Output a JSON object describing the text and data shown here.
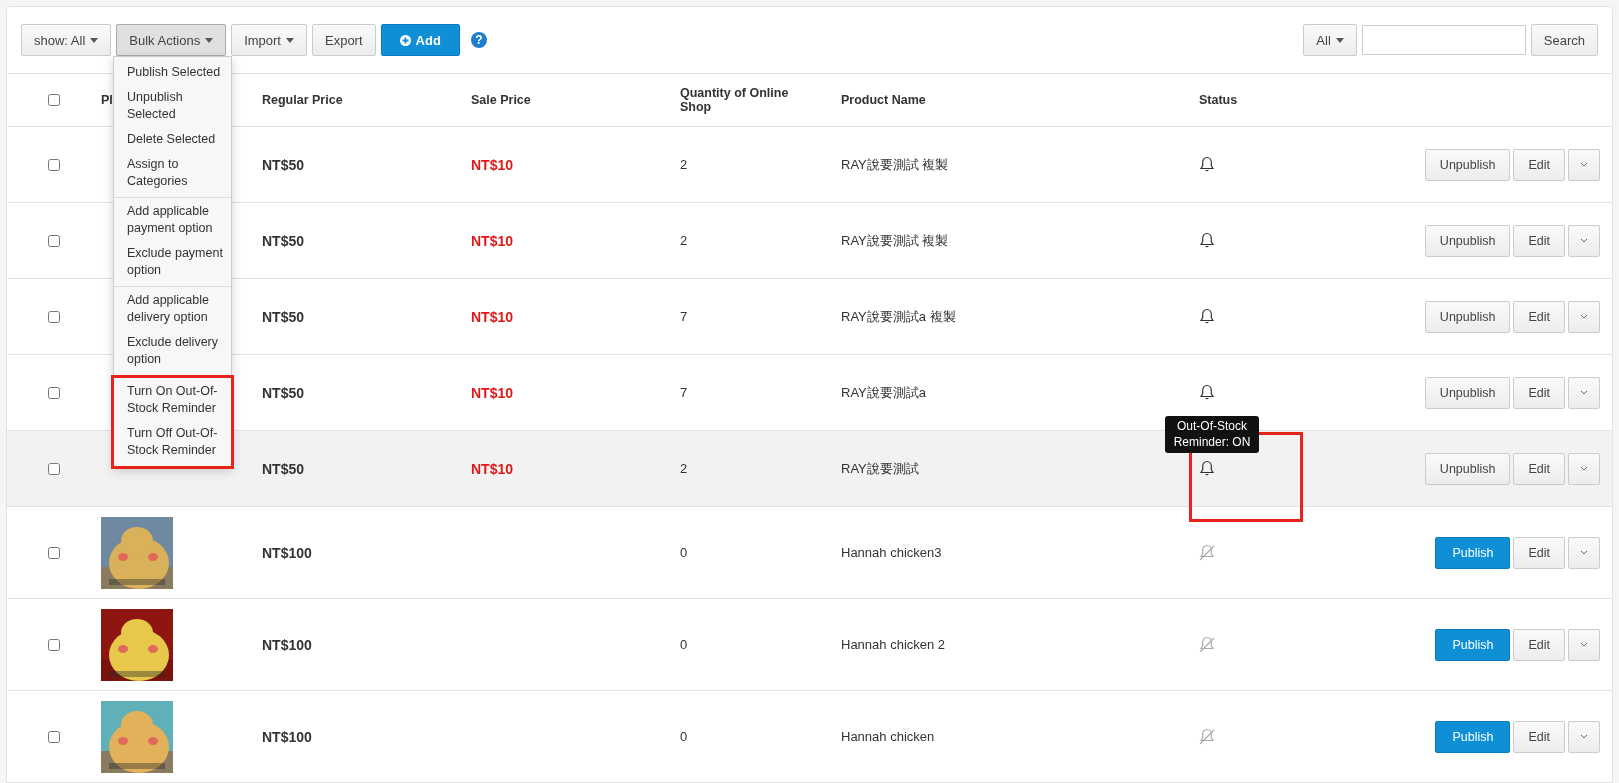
{
  "toolbar": {
    "buttons": [
      {
        "label": "show: All",
        "kind": "dropdown",
        "open": false
      },
      {
        "label": "Bulk Actions",
        "kind": "dropdown",
        "open": true
      },
      {
        "label": "Import",
        "kind": "dropdown",
        "open": false
      },
      {
        "label": "Export",
        "kind": "plain",
        "open": false
      },
      {
        "label": "Add",
        "kind": "primary",
        "open": false
      }
    ],
    "help": "?",
    "filter": {
      "label": "All"
    },
    "search": {
      "button": "Search"
    }
  },
  "bulk_menu": {
    "groups": [
      {
        "highlighted": false,
        "items": [
          "Publish Selected",
          "Unpublish Selected",
          "Delete Selected",
          "Assign to Categories"
        ]
      },
      {
        "highlighted": false,
        "items": [
          "Add applicable payment option",
          "Exclude payment option"
        ]
      },
      {
        "highlighted": false,
        "items": [
          "Add applicable delivery option",
          "Exclude delivery option"
        ]
      },
      {
        "highlighted": true,
        "items": [
          "Turn On Out-Of-Stock Reminder",
          "Turn Off Out-Of-Stock Reminder"
        ]
      }
    ]
  },
  "table": {
    "header_checked": false,
    "columns": [
      "Pl",
      "Regular Price",
      "Sale Price",
      "Quantity of Online Shop",
      "Product Name",
      "Status"
    ],
    "rows": [
      {
        "checked": false,
        "photo": null,
        "regular_price": "NT$50",
        "sale_price": "NT$10",
        "quantity": "2",
        "name": "RAY說要測試 複製",
        "reminder_on": true,
        "hovered": false,
        "highlighted": false,
        "action": {
          "label": "Unpublish",
          "kind": "default"
        },
        "edit": "Edit"
      },
      {
        "checked": false,
        "photo": null,
        "regular_price": "NT$50",
        "sale_price": "NT$10",
        "quantity": "2",
        "name": "RAY說要測試 複製",
        "reminder_on": true,
        "hovered": false,
        "highlighted": false,
        "action": {
          "label": "Unpublish",
          "kind": "default"
        },
        "edit": "Edit"
      },
      {
        "checked": false,
        "photo": null,
        "regular_price": "NT$50",
        "sale_price": "NT$10",
        "quantity": "7",
        "name": "RAY說要測試a 複製",
        "reminder_on": true,
        "hovered": false,
        "highlighted": false,
        "action": {
          "label": "Unpublish",
          "kind": "default"
        },
        "edit": "Edit"
      },
      {
        "checked": false,
        "photo": null,
        "regular_price": "NT$50",
        "sale_price": "NT$10",
        "quantity": "7",
        "name": "RAY說要測試a",
        "reminder_on": true,
        "hovered": false,
        "highlighted": false,
        "action": {
          "label": "Unpublish",
          "kind": "default"
        },
        "edit": "Edit"
      },
      {
        "checked": false,
        "photo": null,
        "regular_price": "NT$50",
        "sale_price": "NT$10",
        "quantity": "2",
        "name": "RAY說要測試",
        "reminder_on": true,
        "hovered": true,
        "highlighted": true,
        "tooltip": "Out-Of-Stock Reminder: ON",
        "action": {
          "label": "Unpublish",
          "kind": "default"
        },
        "edit": "Edit"
      },
      {
        "checked": false,
        "regular_price": "NT$100",
        "quantity": "0",
        "name": "Hannah chicken3",
        "reminder_on": false,
        "hovered": false,
        "highlighted": false,
        "action": {
          "label": "Publish",
          "kind": "primary"
        },
        "edit": "Edit"
      },
      {
        "checked": false,
        "regular_price": "NT$100",
        "quantity": "0",
        "name": "Hannah chicken 2",
        "reminder_on": false,
        "hovered": false,
        "highlighted": false,
        "action": {
          "label": "Publish",
          "kind": "primary"
        },
        "edit": "Edit"
      },
      {
        "checked": false,
        "regular_price": "NT$100",
        "quantity": "0",
        "name": "Hannah chicken",
        "reminder_on": false,
        "hovered": false,
        "highlighted": false,
        "action": {
          "label": "Publish",
          "kind": "primary"
        },
        "edit": "Edit"
      }
    ]
  }
}
